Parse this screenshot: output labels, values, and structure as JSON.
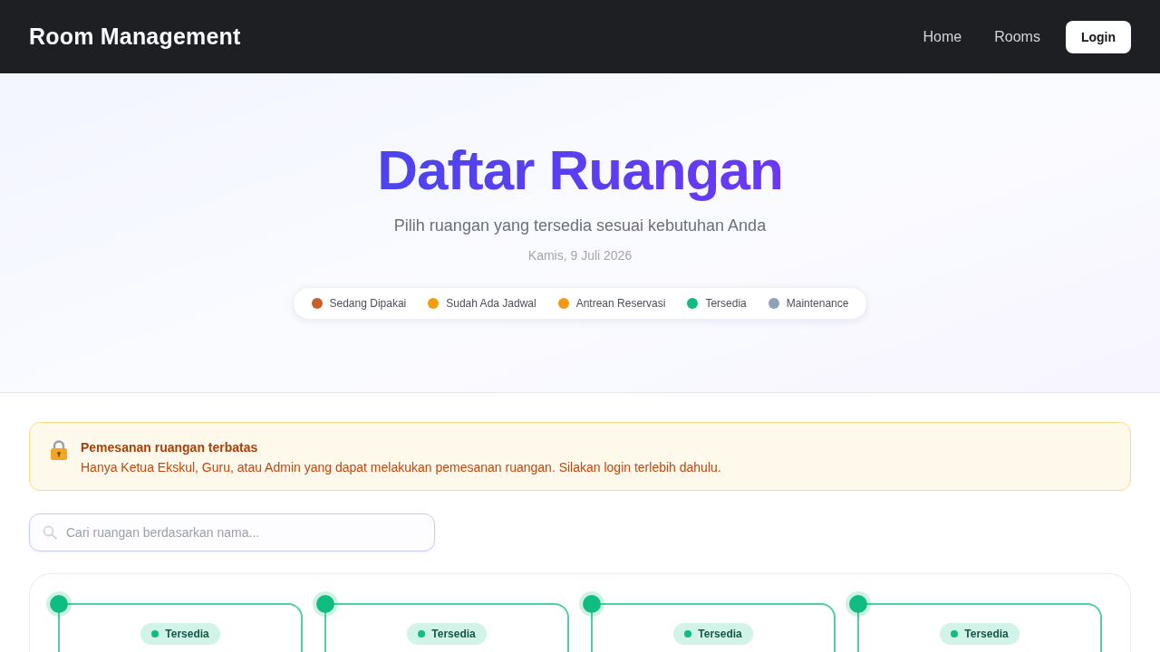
{
  "navbar": {
    "title": "Room Management",
    "links": [
      {
        "label": "Home",
        "kind": "link"
      },
      {
        "label": "Rooms",
        "kind": "link"
      },
      {
        "label": "Login",
        "kind": "button"
      }
    ]
  },
  "hero": {
    "title": "Daftar Ruangan",
    "subtitle": "Pilih ruangan yang tersedia sesuai kebutuhan Anda",
    "date": "Kamis, 9 Juli 2026",
    "legend": [
      {
        "label": "Sedang Dipakai",
        "color": "#c8602a"
      },
      {
        "label": "Sudah Ada Jadwal",
        "color": "#f29e0c"
      },
      {
        "label": "Antrean Reservasi",
        "color": "#f39a12"
      },
      {
        "label": "Tersedia",
        "color": "#10bd80"
      },
      {
        "label": "Maintenance",
        "color": "#8ea2b8"
      }
    ]
  },
  "alert": {
    "title": "Pemesanan ruangan terbatas",
    "message": "Hanya Ketua Ekskul, Guru, atau Admin yang dapat melakukan pemesanan ruangan. Silakan login terlebih dahulu."
  },
  "search": {
    "placeholder": "Cari ruangan berdasarkan nama..."
  },
  "rooms": [
    {
      "status": "Tersedia",
      "color": "#10bd80"
    },
    {
      "status": "Tersedia",
      "color": "#10bd80"
    },
    {
      "status": "Tersedia",
      "color": "#10bd80"
    },
    {
      "status": "Tersedia",
      "color": "#10bd80"
    }
  ]
}
